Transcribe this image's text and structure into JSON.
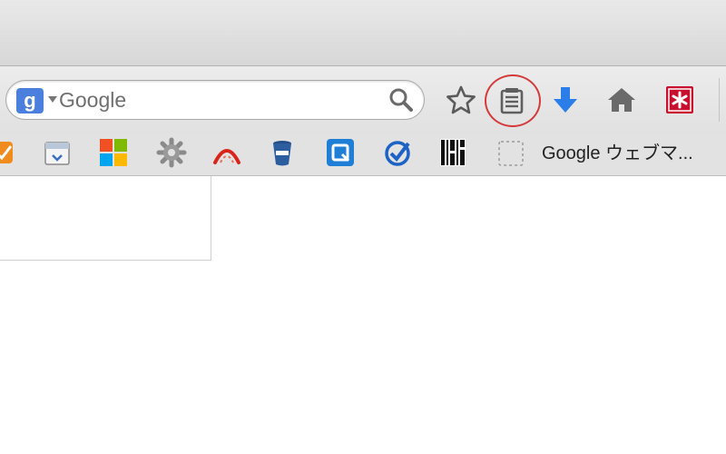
{
  "search": {
    "engine_logo_text": "g",
    "placeholder": "Google"
  },
  "toolbar": {
    "buttons": [
      "bookmark-star",
      "reading-list",
      "downloads",
      "home",
      "addon-extension"
    ],
    "highlight_color": "#d53a3a",
    "download_arrow_color": "#2b7de9"
  },
  "bookmarks_bar": {
    "items": [
      {
        "icon": "orange-check-icon"
      },
      {
        "icon": "calendar-icon"
      },
      {
        "icon": "microsoft-logo-icon"
      },
      {
        "icon": "gear-icon"
      },
      {
        "icon": "red-arc-icon"
      },
      {
        "icon": "bucket-icon"
      },
      {
        "icon": "q-logo-icon"
      },
      {
        "icon": "blue-checkmark-icon"
      },
      {
        "icon": "barcode-icon"
      },
      {
        "icon": "dashed-placeholder-icon"
      }
    ],
    "last_label": "Google ウェブマ..."
  }
}
